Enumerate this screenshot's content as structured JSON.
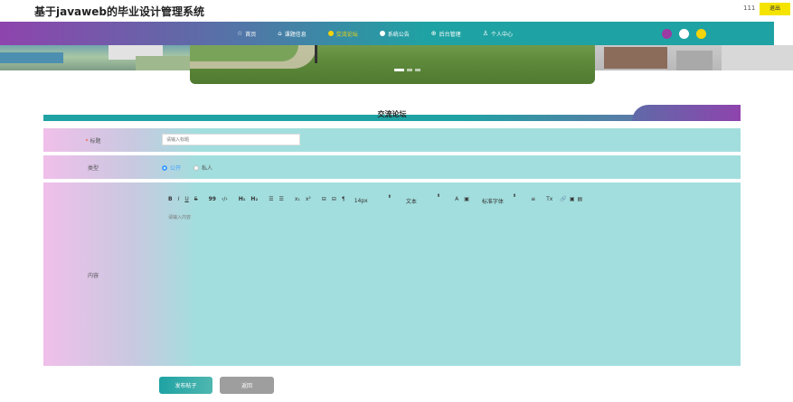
{
  "site": {
    "title": "基于javaweb的毕业设计管理系统"
  },
  "user": {
    "name": "111",
    "logout_label": "退出"
  },
  "nav": {
    "items": [
      {
        "icon": "☆",
        "label": "首页",
        "active": false
      },
      {
        "icon": "⌂",
        "label": "课题信息",
        "active": false
      },
      {
        "icon": "●",
        "label": "交流论坛",
        "active": true
      },
      {
        "icon": "●",
        "label": "系统公告",
        "active": false
      },
      {
        "icon": "⊕",
        "label": "后台管理",
        "active": false
      },
      {
        "icon": "♙",
        "label": "个人中心",
        "active": false
      }
    ],
    "theme_colors": [
      "#9b3aa3",
      "#ffffff",
      "#f4d40a"
    ]
  },
  "section": {
    "title": "交流论坛"
  },
  "form": {
    "title_label": "标题",
    "title_placeholder": "请输入标题",
    "type_label": "类型",
    "type_options": [
      "公开",
      "私人"
    ],
    "type_selected": "公开",
    "content_label": "内容",
    "content_placeholder": "请输入内容",
    "toolbar": {
      "bold": "B",
      "italic": "I",
      "underline": "U",
      "strike": "S",
      "quote": "99",
      "code": "‹/›",
      "h1": "H₁",
      "h2": "H₂",
      "ol": "☰",
      "ul": "☰",
      "sub": "x₁",
      "sup": "x²",
      "indent_left": "⊟",
      "indent_right": "⊟",
      "direction": "¶",
      "font_size": "14px",
      "header": "文本",
      "color": "A",
      "background": "▣",
      "font": "标准字体",
      "align": "≡",
      "clean": "Tx",
      "link": "🔗",
      "image": "▣",
      "video": "▤"
    }
  },
  "buttons": {
    "submit": "发布帖子",
    "cancel": "返回"
  },
  "accent": "#1fa2a3",
  "accent2": "#8e44ad"
}
